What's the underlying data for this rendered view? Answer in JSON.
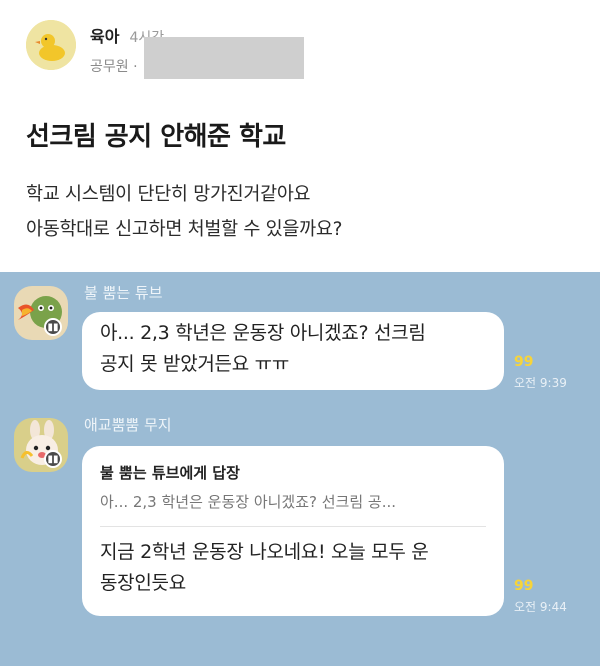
{
  "post": {
    "board": "육아",
    "time": "4시간",
    "job": "공무원 ·",
    "title": "선크림 공지 안해준 학교",
    "body_line1": "학교 시스템이 단단히 망가진거같아요",
    "body_line2": "아동학대로 신고하면 처벌할 수 있을까요?"
  },
  "chat": {
    "messages": [
      {
        "sender": "불 뿜는 튜브",
        "text_line1": "아... 2,3 학년은 운동장 아니겠죠? 선크림",
        "text_line2": "공지 못 받았거든요 ㅠㅠ",
        "unread": "99",
        "time": "오전 9:39"
      },
      {
        "sender": "애교뿜뿜 무지",
        "reply_head": "불 뿜는 튜브에게 답장",
        "reply_quote": "아... 2,3 학년은 운동장 아니겠죠? 선크림 공...",
        "text_line1": "지금 2학년 운동장 나오네요! 오늘 모두 운",
        "text_line2": "동장인듯요",
        "unread": "99",
        "time": "오전 9:44"
      }
    ]
  },
  "colors": {
    "chat_bg": "#9bbbd4",
    "unread": "#f7d43a",
    "bubble": "#ffffff"
  }
}
